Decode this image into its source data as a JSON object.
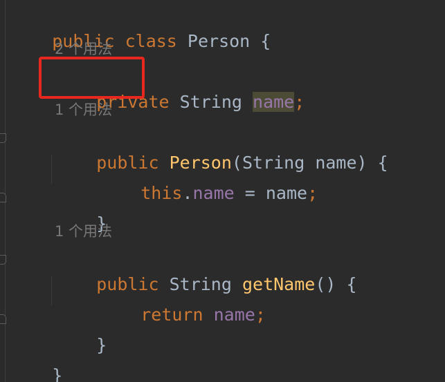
{
  "code": {
    "line1": {
      "kw1": "public",
      "kw2": "class",
      "name": "Person",
      "brace": "{"
    },
    "hint1": "2 个用法",
    "line2": {
      "kw": "private",
      "type": "String",
      "field": "name",
      "semi": ";"
    },
    "hint2": "1 个用法",
    "line3": {
      "kw": "public",
      "ctor": "Person",
      "params": "(String name) {"
    },
    "line4": {
      "this": "this",
      "dot": ".",
      "field": "name",
      "rest": " = name",
      "semi": ";"
    },
    "line5": {
      "brace": "}"
    },
    "hint3": "1 个用法",
    "line6": {
      "kw": "public",
      "type": "String",
      "method": "getName",
      "rest": "() {"
    },
    "line7": {
      "kw": "return",
      "field": "name",
      "semi": ";"
    },
    "line8": {
      "brace": "}"
    },
    "line9": {
      "brace": "}"
    }
  },
  "colors": {
    "background": "#2b2b2b",
    "keyword": "#cc7832",
    "method": "#ffc66d",
    "field": "#9876aa",
    "text": "#a9b7c6",
    "hint": "#787878",
    "highlight_box": "#e8281f"
  }
}
